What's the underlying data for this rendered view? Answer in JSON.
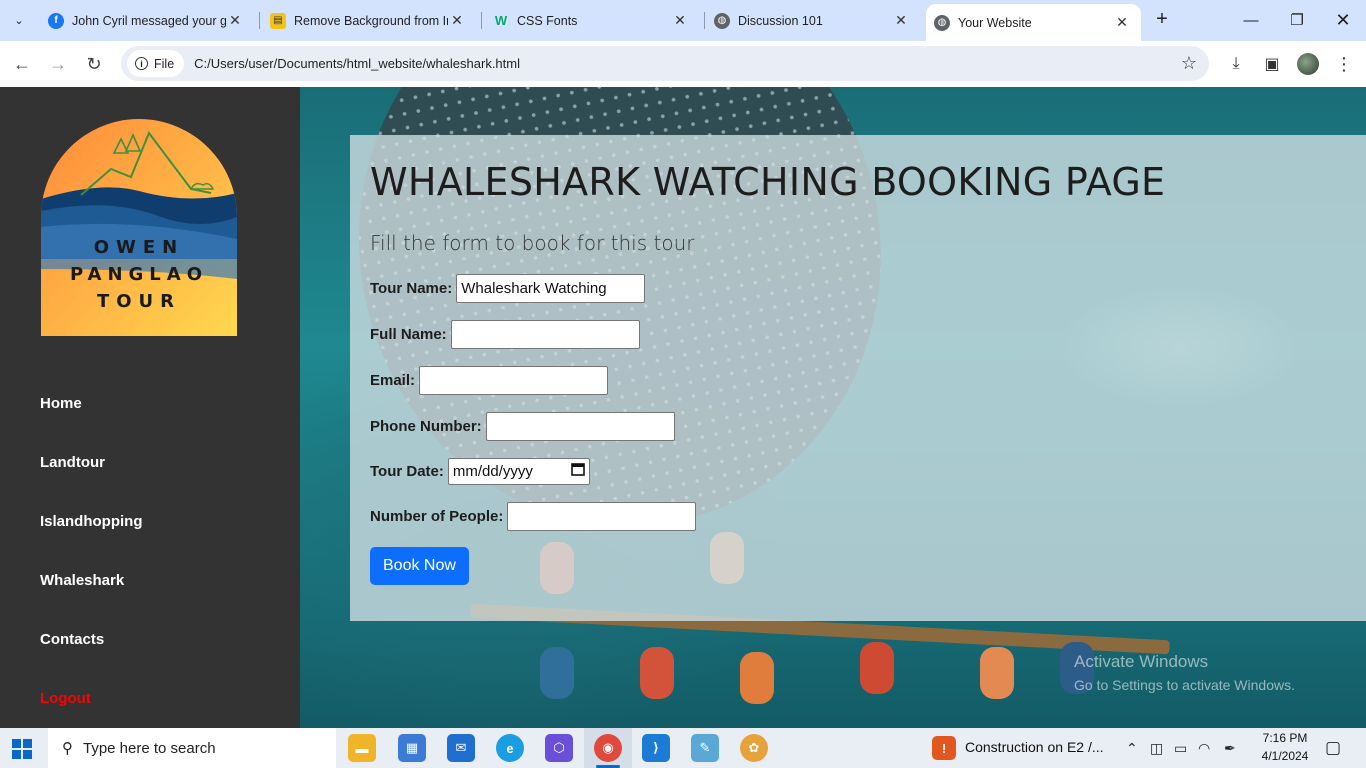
{
  "browser": {
    "tabs": [
      {
        "title": "John Cyril messaged your gr",
        "favicon": "facebook-icon",
        "color": "#1877f2",
        "active": false
      },
      {
        "title": "Remove Background from Im",
        "favicon": "remove-bg-icon",
        "color": "#f3c318",
        "active": false
      },
      {
        "title": "CSS Fonts",
        "favicon": "w3schools-icon",
        "color": "#04aa6d",
        "active": false
      },
      {
        "title": "Discussion 101",
        "favicon": "globe-icon",
        "color": "#5f6368",
        "active": false
      },
      {
        "title": "Your Website",
        "favicon": "globe-icon",
        "color": "#5f6368",
        "active": true
      }
    ],
    "site_chip": "File",
    "url": "C:/Users/user/Documents/html_website/whaleshark.html"
  },
  "sidebar": {
    "logo": {
      "line1": "OWEN",
      "line2": "PANGLAO",
      "line3": "TOUR"
    },
    "nav": [
      {
        "label": "Home"
      },
      {
        "label": "Landtour"
      },
      {
        "label": "Islandhopping"
      },
      {
        "label": "Whaleshark"
      },
      {
        "label": "Contacts"
      },
      {
        "label": "Logout",
        "color": "#ff0000"
      }
    ]
  },
  "form": {
    "title": "WHALESHARK WATCHING BOOKING PAGE",
    "subtitle": "Fill the form to book for this tour",
    "fields": {
      "tour_name": {
        "label": "Tour Name:",
        "value": "Whaleshark Watching"
      },
      "full_name": {
        "label": "Full Name:",
        "value": ""
      },
      "email": {
        "label": "Email:",
        "value": ""
      },
      "phone": {
        "label": "Phone Number:",
        "value": ""
      },
      "tour_date": {
        "label": "Tour Date:",
        "placeholder": "mm/dd/yyyy"
      },
      "people": {
        "label": "Number of People:",
        "value": ""
      }
    },
    "submit_label": "Book Now",
    "submit_color": "#0d6efd"
  },
  "watermark": {
    "line1": "Activate Windows",
    "line2": "Go to Settings to activate Windows."
  },
  "taskbar": {
    "search_placeholder": "Type here to search",
    "notification": "Construction on E2 /...",
    "time": "7:16 PM",
    "date": "4/1/2024"
  }
}
